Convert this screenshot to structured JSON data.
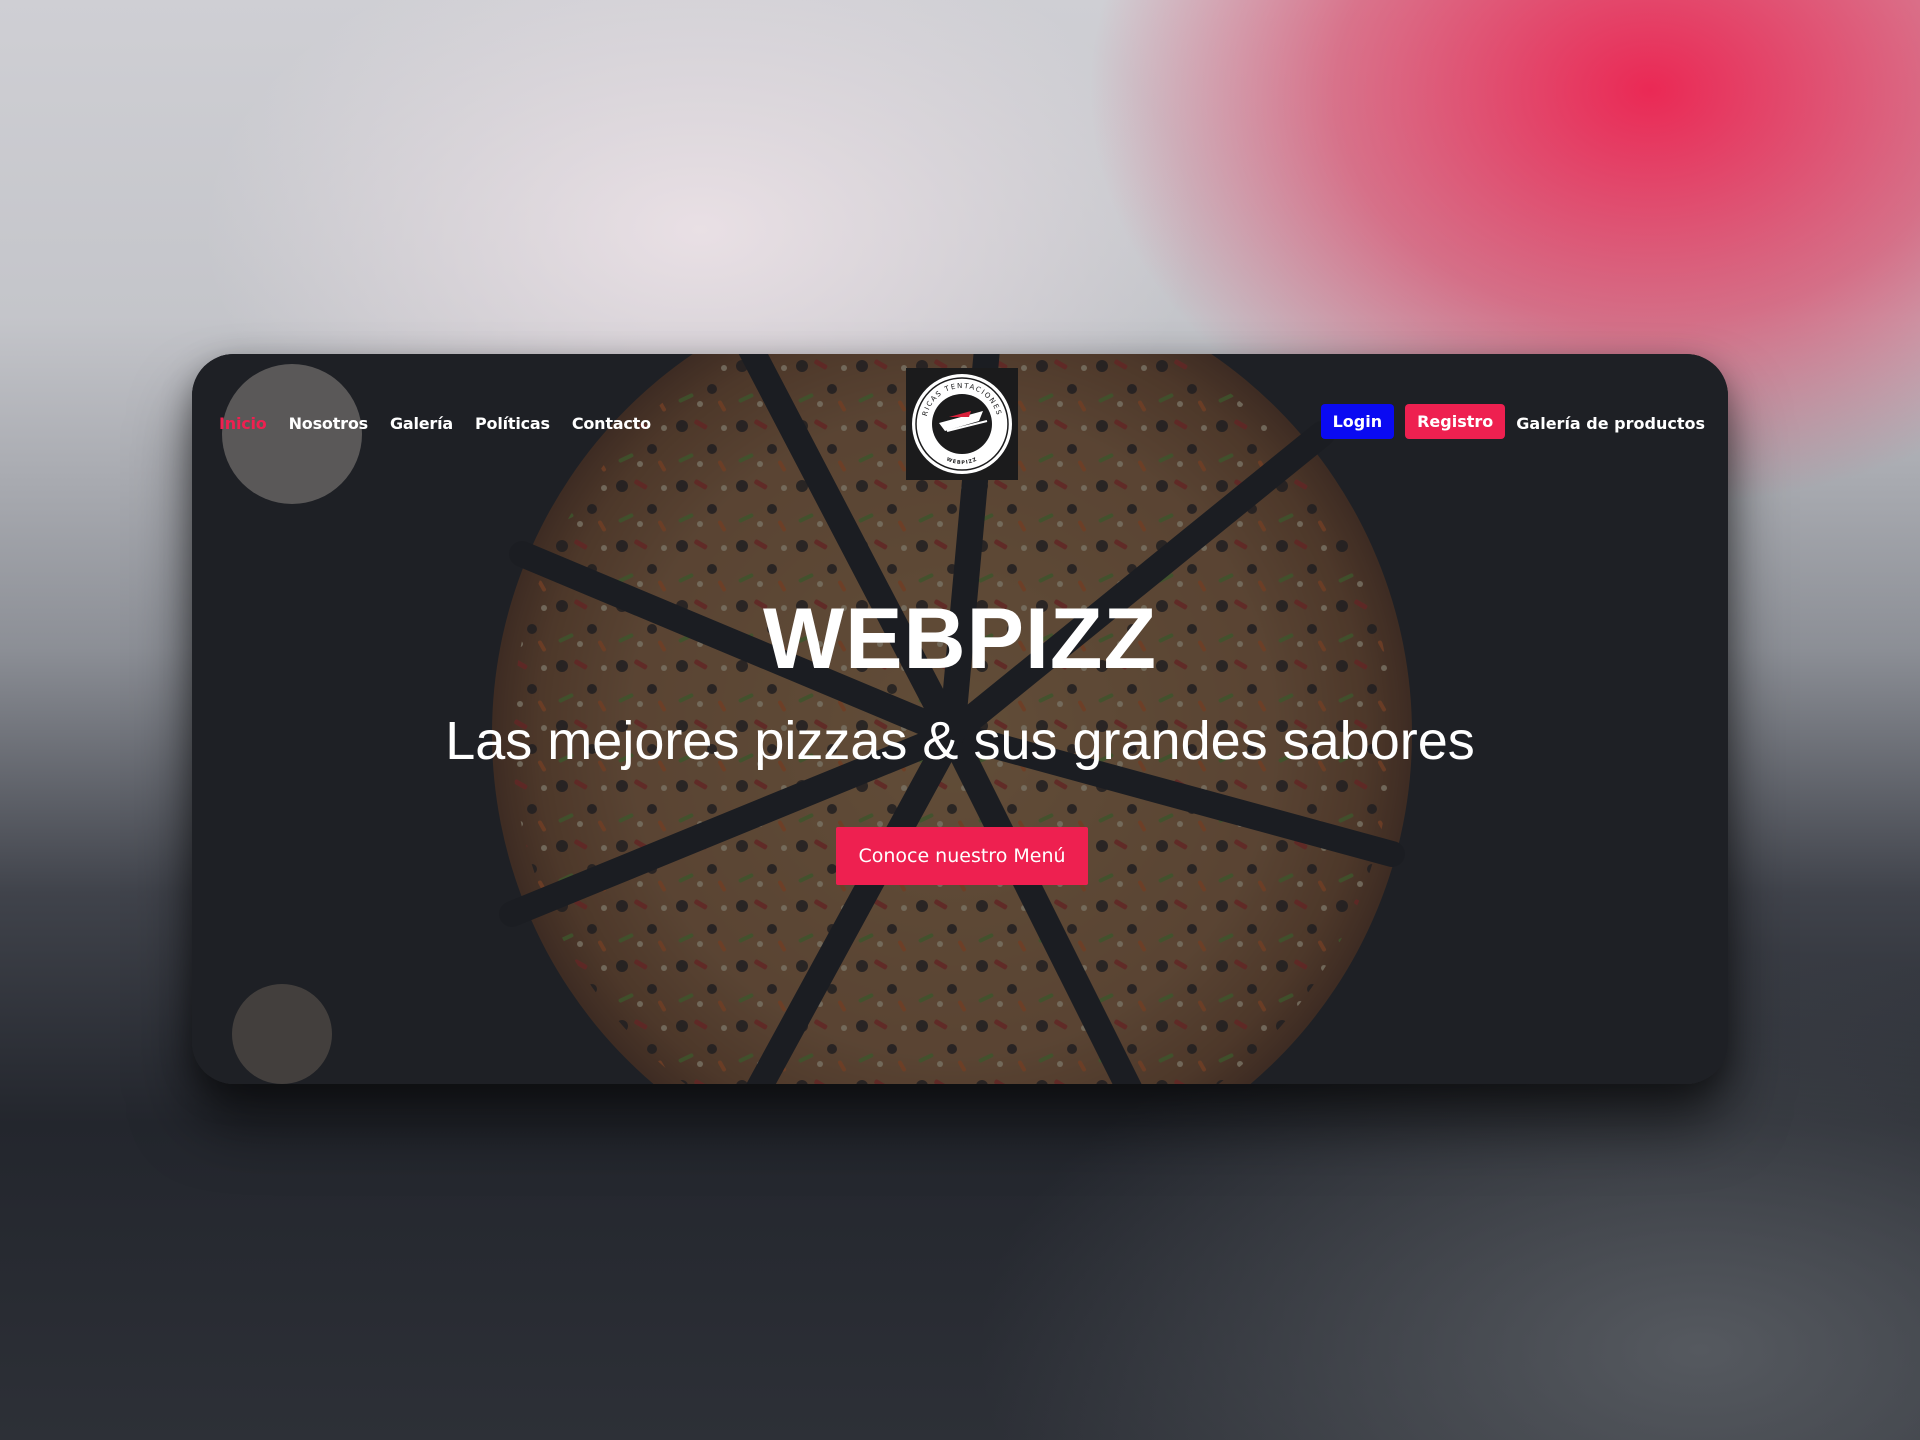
{
  "nav": {
    "links": [
      {
        "label": "Inicio",
        "active": true
      },
      {
        "label": "Nosotros",
        "active": false
      },
      {
        "label": "Galería",
        "active": false
      },
      {
        "label": "Políticas",
        "active": false
      },
      {
        "label": "Contacto",
        "active": false
      }
    ],
    "login_label": "Login",
    "registro_label": "Registro",
    "gallery_label": "Galería de productos"
  },
  "logo": {
    "top_text": "RICAS TENTACIONES",
    "bottom_text": "WEBPIZZ"
  },
  "hero": {
    "title": "WEBPIZZ",
    "subtitle": "Las mejores pizzas & sus grandes sabores",
    "cta_label": "Conoce nuestro Menú"
  },
  "colors": {
    "accent": "#ee2050",
    "login_blue": "#0a0af2",
    "text": "#ffffff"
  },
  "icons": {
    "logo": "pizza-logo-icon"
  }
}
